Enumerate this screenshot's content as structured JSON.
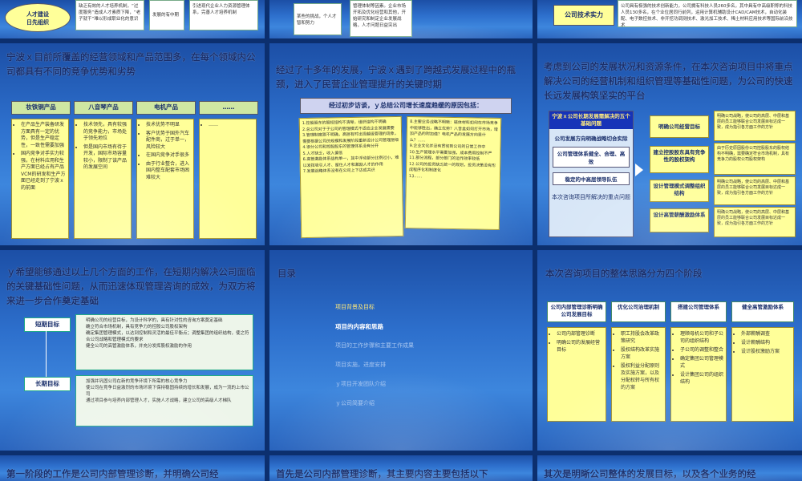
{
  "s1": {
    "oval_label": "人才建设\n日先组织",
    "box1": "缺乏有效的人才培养机制，“过度服务”造成人才素质下降，“老子就干”难以形成职业化的意识",
    "box2": "发展的有中期",
    "box3": "引进现代企业人力资源管理体系，完善人才培养机制"
  },
  "s2": {
    "box1": "某些的挑战，个人才智和努力",
    "box2": "管理体制等因素。企业市场开拓及优化经营和其他，开始研究和制定企业发展战略，人才问题日益突出"
  },
  "s3": {
    "label": "公司技术实力",
    "text": "公司具有极强的技术创新能力，公司拥有科技人员260多名，其中具有中高级职称的科技人员130多名，在个业位居同行前列，运用计算机辅助设计CAD/CAM技术，自动化装配、电子数控技术、非开挖功调测技术、激光加工技术、稀土材料应用技术等国际前沿技术"
  },
  "s4": {
    "title": "宁波ｘ目前所覆盖的经营领域和产品范围多，在每个领域内公司都具有不同的竞争优势和劣势",
    "headers": [
      "妆铁铜产品",
      "八音琴产品",
      "电机产品",
      "……"
    ],
    "col1": [
      "在产品生产装备研发方面具有一定的优势，但是生产稳定性，一致性需要加强",
      "国内竞争对手实力较强，在材料应用和生产方面已经占有产品VCM的研发和生产方面已经走到了宁波ｘ的前面"
    ],
    "col2": [
      "技术领先，具有较强的竞争能力，市场处于领先地位",
      "但是国内市场有待于开发，国际市场容量较小，限制了该产品的发展空间"
    ],
    "col3": [
      "技术优势不明显",
      "客户优势于国外汽车配件商，过于单一，风险较大",
      "在国内竞争对手很多",
      "由于行业整合，进入国内整车配套市场困难较大"
    ],
    "col4": [
      "……"
    ]
  },
  "s5": {
    "title": "经过了十多年的发展，宁波ｘ遇到了跨越式发展过程中的瓶颈，进入了民营企业管理提升的关键时期",
    "banner": "经过初步访谈，ｙ总结公司增长速度趋缓的原因包括：",
    "left": [
      "1.控股股东的股权结构不清晰，组织结构不明确",
      "2.总公司对于子公司的管理模式不适应企业发展需要",
      "3.管理制度跟不明确，高层有时出现越级管理的现象，需要根据公司的规模和发展阶段重新设计公司管理层级",
      "4.很分公司和控股股东的管理体系没有分开",
      "5.人才缺乏，收入偏低",
      "6.高管激励体系结构单一，其中浮动部分比例过小，难以发挥吸引人才、留住人才和激励人才的作用",
      "7.发展战略体系没有在公司上下达成共识"
    ],
    "right": [
      "8.主要业务战略不明晰：磁体材料如何在市场竞争中能够胜出，确立优势？八音盒如何打开市场，增加产品的附加值？电机产品的发展方向是什么？……",
      "9.企业文化并没有贯彻到公司的日常工作中",
      "10.生产管理水平需要加强，成本费用控制不严",
      "11.部分流程，部分部门的运作效率较低",
      "12.公司的投资缺乏统一的规划，投资决策没有形成程序化和制度化",
      "13……"
    ]
  },
  "s6": {
    "title": "考虑到公司的发展状况和资源条件，在本次咨询项目中将重点解决公司的经营机制和组织管理等基础性问题，为公司的快速长远发展构筑坚实的平台",
    "left_header": "宁波ｘ公司长期发展需解决的五个基础问题",
    "left_items": [
      "公司发展方向明确战略切合实际",
      "公司管理体系健全、合理、高效",
      "稳定的中高层领导队伍"
    ],
    "caption": "本次咨询项目所解决的重点问题",
    "mid_items": [
      "明确公司经营目标",
      "建立控股股东具有竞争性的股权架构",
      "设计管理模式调整组织结构",
      "设计高管薪酬激励体系"
    ],
    "right_items": [
      "明确公司战略，使公司的高层、中层和基层的员工能够联合公司发展目标达成一致，成为指引各方面工作的方针",
      "由于历史原因股份公司控股股东的股权结构不明确，需要确定符合市场机制，具有竞争力的股权公司股权架构",
      "明确公司战略，使公司的高层、中层和基层的员工能够联合公司发展目标达成一致，成为指引各方面工作的方针",
      "明确公司战略，使公司的高层、中层和基层的员工能够联合公司发展目标达成一致，成为指引各方面工作的方针"
    ]
  },
  "s7": {
    "title": "ｙ希望能够通过以上几个方面的工作，在短期内解决公司面临的关键基础性问题，从而迅速体现管理咨询的成效，为双方将来进一步合作奠定基础",
    "short_label": "短期目标",
    "long_label": "长期目标",
    "short_items": [
      "明确公司的经营目标，为设计科学的，具有针对性的咨询方案奠定基础",
      "确立符合市场机制，具有竞争力的控股公司股权架构",
      "确定集团管理模式，以达到控制和灵活的最佳平衡点；调整集团的组织结构，使之符合公司战略和管理模式的要求",
      "健全公司的高管激励体系，并充分发挥股权激励的作用"
    ],
    "long_items": [
      "加强并巩固公司在新的竞争环境下所需的核心竞争力",
      "使公司在竞争日益激烈的市场环境下保持稳固持续的增长和发展，成为一流的上市公司",
      "通过项目参与培养内部管理人才，实施人才战略，建立公司的高级人才梯队"
    ]
  },
  "s8": {
    "title": "目录",
    "items": [
      "项目背景及目标",
      "项目的内容和思路",
      "项目的工作步骤和主要工作成果",
      "项目实施，进度安排",
      "ｙ项目开发团队介绍",
      "ｙ公司简要介绍"
    ]
  },
  "s9": {
    "title": "本次咨询项目的整体思路分为四个阶段",
    "stages": [
      "公司内部管理诊断明确公司发展目标",
      "优化公司治理机制",
      "搭建公司管理体系",
      "健全高管激励体系"
    ],
    "col1": [
      "公司内部管理诊断",
      "明确公司的发展经营目标"
    ],
    "col2": [
      "职工持股会改革政策研究",
      "股权结构改革实施方案",
      "股权利益分配原则及实施方案，以及分配权转与所有权的方案"
    ],
    "col3": [
      "理顺母机公司和子公司的组织结构",
      "子公司的调整和整合",
      "确定集团公司管理模式",
      "设计集团公司的组织结构"
    ],
    "col4": [
      "外部薪酬调查",
      "设计薪酬结构",
      "设计股权激励方案"
    ]
  },
  "s10": {
    "title": "第一阶段的工作是公司内部管理诊断，并明确公司经"
  },
  "s11": {
    "title": "首先是公司内部管理诊断，其主要内容主要包括以下"
  },
  "s12": {
    "title": "其次是明晰公司整体的发展目标，以及各个业务的经"
  },
  "colors": {
    "title": "#1a2f6b",
    "yellow_box": "#ffff99",
    "header_green": "#cfe7a2",
    "bg": "#2d6fcc"
  }
}
